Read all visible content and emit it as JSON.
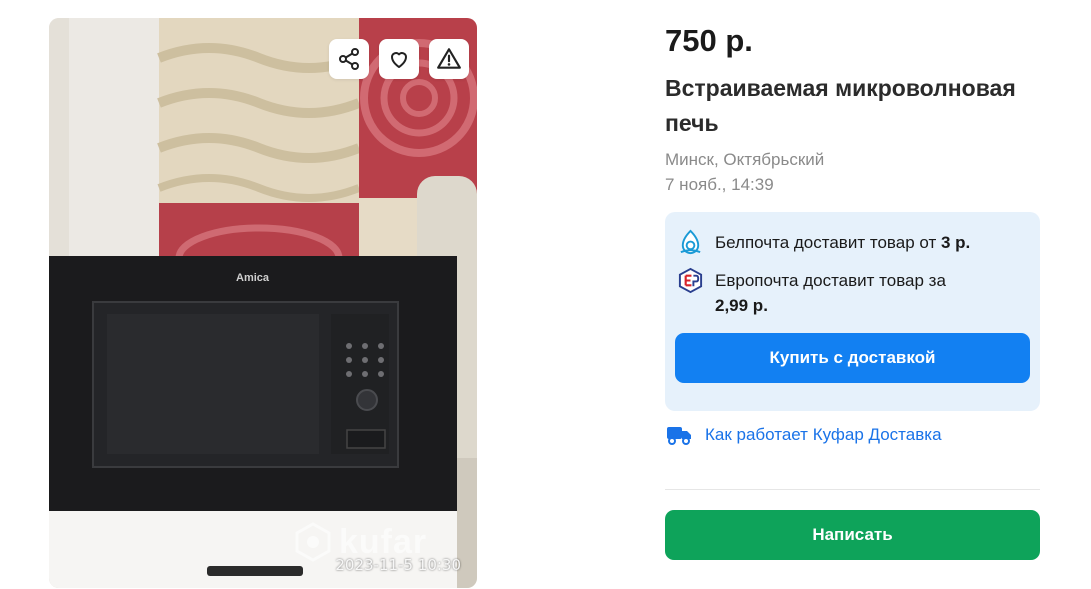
{
  "listing": {
    "price": "750 р.",
    "title": "Встраиваемая микроволновая печь",
    "location": "Минск, Октябрьский",
    "date": "7 нояб., 14:39"
  },
  "photo": {
    "appliance_brand": "Amica",
    "watermark": "kufar",
    "timestamp": "2023-11-5 10:30",
    "actions": [
      "share-icon",
      "heart-icon",
      "warning-icon"
    ]
  },
  "delivery": {
    "belpochta_text": "Белпочта доставит товар от",
    "belpochta_price": "3 р.",
    "europochta_text": "Европочта доставит товар за",
    "europochta_price": "2,99 р.",
    "buy_button": "Купить с доставкой"
  },
  "how_link": "Как работает Куфар Доставка",
  "write_button": "Написать",
  "colors": {
    "buy": "#1280f2",
    "write": "#0ea35a",
    "delivery_bg": "#e6f1fb",
    "link": "#1a73e8"
  }
}
